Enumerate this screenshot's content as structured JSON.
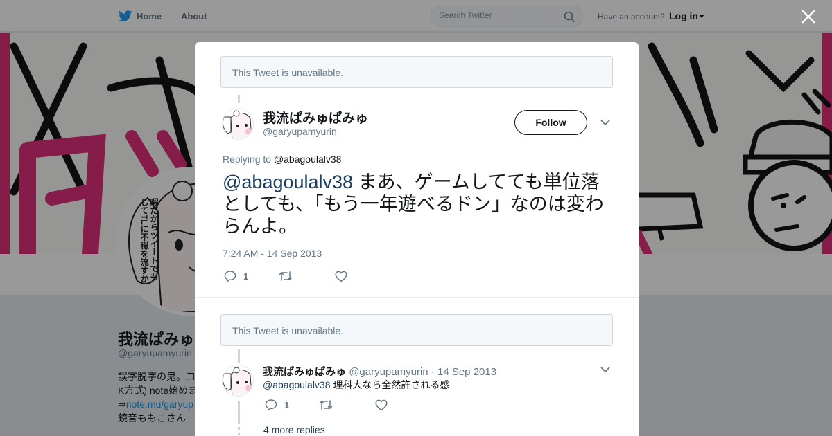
{
  "nav": {
    "home_label": "Home",
    "about_label": "About",
    "search_placeholder": "Search Twitter",
    "have_account": "Have an account?",
    "login_label": "Log in"
  },
  "profile": {
    "name": "我流ぱみゅぱみゅ",
    "handle": "@garyupamyurin",
    "bio_line1": "誤字脱字の鬼。コ",
    "bio_line2": "K方式) note始めま",
    "bio_line3_prefix": "⇒",
    "bio_line3_link": "note.mu/garyup",
    "bio_line4": "鏡音ももこさん",
    "avatar_text": "暇だからツイートでもしてTLに不穏を流すか"
  },
  "modal": {
    "unavailable_1": "This Tweet is unavailable.",
    "unavailable_2": "This Tweet is unavailable.",
    "main_tweet": {
      "author_name": "我流ぱみゅぱみゅ",
      "author_handle": "@garyupamyurin",
      "follow_label": "Follow",
      "replying_prefix": "Replying to",
      "replying_to": "@abagoulalv38",
      "text_mention": "@abagoulalv38",
      "text_body": " まあ、ゲームしてても単位落としても、「もう一年遊べるドン」なのは変わらんよ。",
      "timestamp": "7:24 AM - 14 Sep 2013",
      "reply_count": "1"
    },
    "reply_tweet": {
      "author_name": "我流ぱみゅぱみゅ",
      "author_handle": "@garyupamyurin",
      "separator": "·",
      "date": "14 Sep 2013",
      "text_mention": "@abagoulalv38",
      "text_body": " 理科大なら全然許される感",
      "reply_count": "1"
    },
    "more_replies": "4 more replies"
  },
  "colors": {
    "twitter_blue": "#1da1f2",
    "link_blue": "#1b95e0",
    "banner_pink": "#e0307a",
    "text_dark": "#14171a",
    "text_gray": "#657786"
  },
  "icons": [
    "twitter-bird-icon",
    "search-icon",
    "caret-down-icon",
    "close-icon",
    "chevron-down-icon",
    "reply-icon",
    "retweet-icon",
    "heart-icon"
  ]
}
